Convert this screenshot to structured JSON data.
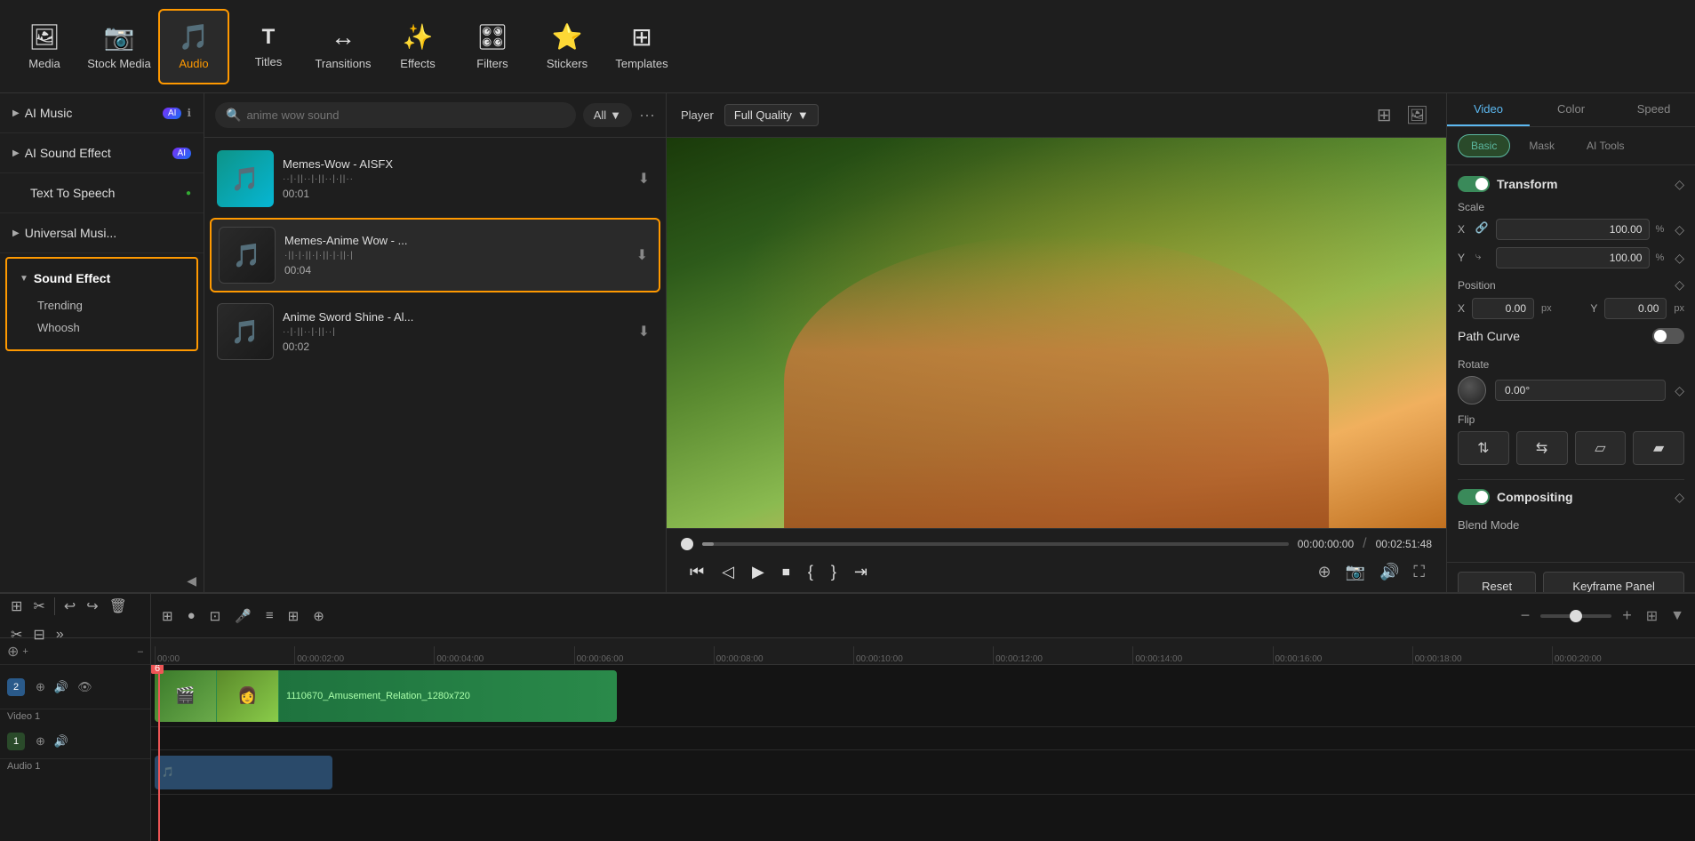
{
  "toolbar": {
    "items": [
      {
        "id": "media",
        "label": "Media",
        "icon": "🖼"
      },
      {
        "id": "stock_media",
        "label": "Stock Media",
        "icon": "📷"
      },
      {
        "id": "audio",
        "label": "Audio",
        "icon": "🎵",
        "active": true
      },
      {
        "id": "titles",
        "label": "Titles",
        "icon": "T"
      },
      {
        "id": "transitions",
        "label": "Transitions",
        "icon": "↔"
      },
      {
        "id": "effects",
        "label": "Effects",
        "icon": "✨"
      },
      {
        "id": "filters",
        "label": "Filters",
        "icon": "🎛"
      },
      {
        "id": "stickers",
        "label": "Stickers",
        "icon": "⭐"
      },
      {
        "id": "templates",
        "label": "Templates",
        "icon": "⊞"
      }
    ]
  },
  "left_panel": {
    "sections": [
      {
        "id": "ai_music",
        "label": "AI Music",
        "arrow": "▶",
        "has_badge": true,
        "badge_text": "AI",
        "has_info": true,
        "collapsed": true
      },
      {
        "id": "ai_sound_effect",
        "label": "AI Sound Effect",
        "arrow": "▶",
        "has_badge": true,
        "badge_text": "AI",
        "collapsed": true
      },
      {
        "id": "text_to_speech",
        "label": "Text To Speech",
        "arrow": "",
        "dot": "🟢",
        "collapsed": true
      },
      {
        "id": "universal_music",
        "label": "Universal Musi...",
        "arrow": "▶",
        "collapsed": true
      },
      {
        "id": "sound_effect",
        "label": "Sound Effect",
        "arrow": "▼",
        "active": true,
        "collapsed": false
      }
    ],
    "sound_effect_sub": [
      {
        "id": "trending",
        "label": "Trending"
      },
      {
        "id": "whoosh",
        "label": "Whoosh"
      }
    ],
    "collapse_btn": "◀"
  },
  "audio_panel": {
    "search_placeholder": "anime wow sound",
    "filter_label": "All",
    "items": [
      {
        "id": "item1",
        "title": "Memes-Wow - AISFX",
        "duration": "00:01",
        "wave": "··|·||··|·||··|·||··",
        "thumb_type": "teal",
        "selected": false
      },
      {
        "id": "item2",
        "title": "Memes-Anime Wow - ...",
        "duration": "00:04",
        "wave": "·||·|·||·|·||·|·||·|",
        "thumb_type": "dark",
        "selected": true
      },
      {
        "id": "item3",
        "title": "Anime Sword Shine - Al...",
        "duration": "00:02",
        "wave": "··|·||··|·||··|",
        "thumb_type": "dark",
        "selected": false
      }
    ]
  },
  "player": {
    "label": "Player",
    "quality": "Full Quality",
    "current_time": "00:00:00:00",
    "total_time": "00:02:51:48",
    "progress_pct": 2
  },
  "right_panel": {
    "main_tabs": [
      "Video",
      "Color",
      "Speed"
    ],
    "active_main_tab": "Video",
    "sub_tabs": [
      "Basic",
      "Mask",
      "AI Tools"
    ],
    "active_sub_tab": "Basic",
    "transform": {
      "label": "Transform",
      "enabled": true
    },
    "scale": {
      "label": "Scale",
      "x_value": "100.00",
      "y_value": "100.00",
      "unit": "%"
    },
    "position": {
      "label": "Position",
      "x_label": "X",
      "x_value": "0.00",
      "x_unit": "px",
      "y_label": "Y",
      "y_value": "0.00",
      "y_unit": "px"
    },
    "path_curve": {
      "label": "Path Curve",
      "enabled": false
    },
    "rotate": {
      "label": "Rotate",
      "value": "0.00°"
    },
    "flip": {
      "label": "Flip",
      "buttons": [
        "⇅",
        "⇆",
        "⬜",
        "⬛"
      ]
    },
    "compositing": {
      "label": "Compositing",
      "enabled": true
    },
    "blend_mode": {
      "label": "Blend Mode"
    },
    "reset_btn": "Reset",
    "keyframe_btn": "Keyframe Panel"
  },
  "timeline": {
    "ruler_marks": [
      "00:00",
      "00:00:02:00",
      "00:00:04:00",
      "00:00:06:00",
      "00:00:08:00",
      "00:00:10:00",
      "00:00:12:00",
      "00:00:14:00",
      "00:00:16:00",
      "00:00:18:00",
      "00:00:20:00"
    ],
    "tracks": [
      {
        "id": "video1",
        "type": "video",
        "name": "Video 1",
        "clip_title": "1110670_Amusement_Relation_1280x720"
      },
      {
        "id": "audio1",
        "type": "audio",
        "name": "Audio 1"
      }
    ],
    "add_minus_label": "–"
  },
  "icons": {
    "search": "🔍",
    "download": "⬇",
    "more": "···",
    "collapse": "◀",
    "diamond": "◇",
    "play": "▶",
    "pause": "⏸",
    "rewind": "⏮",
    "forward": "⏭",
    "stop": "⏹",
    "loop_in": "{",
    "loop_out": "}",
    "fullscreen": "⛶",
    "screenshot": "📷",
    "volume": "🔊",
    "expand": "⛶"
  }
}
